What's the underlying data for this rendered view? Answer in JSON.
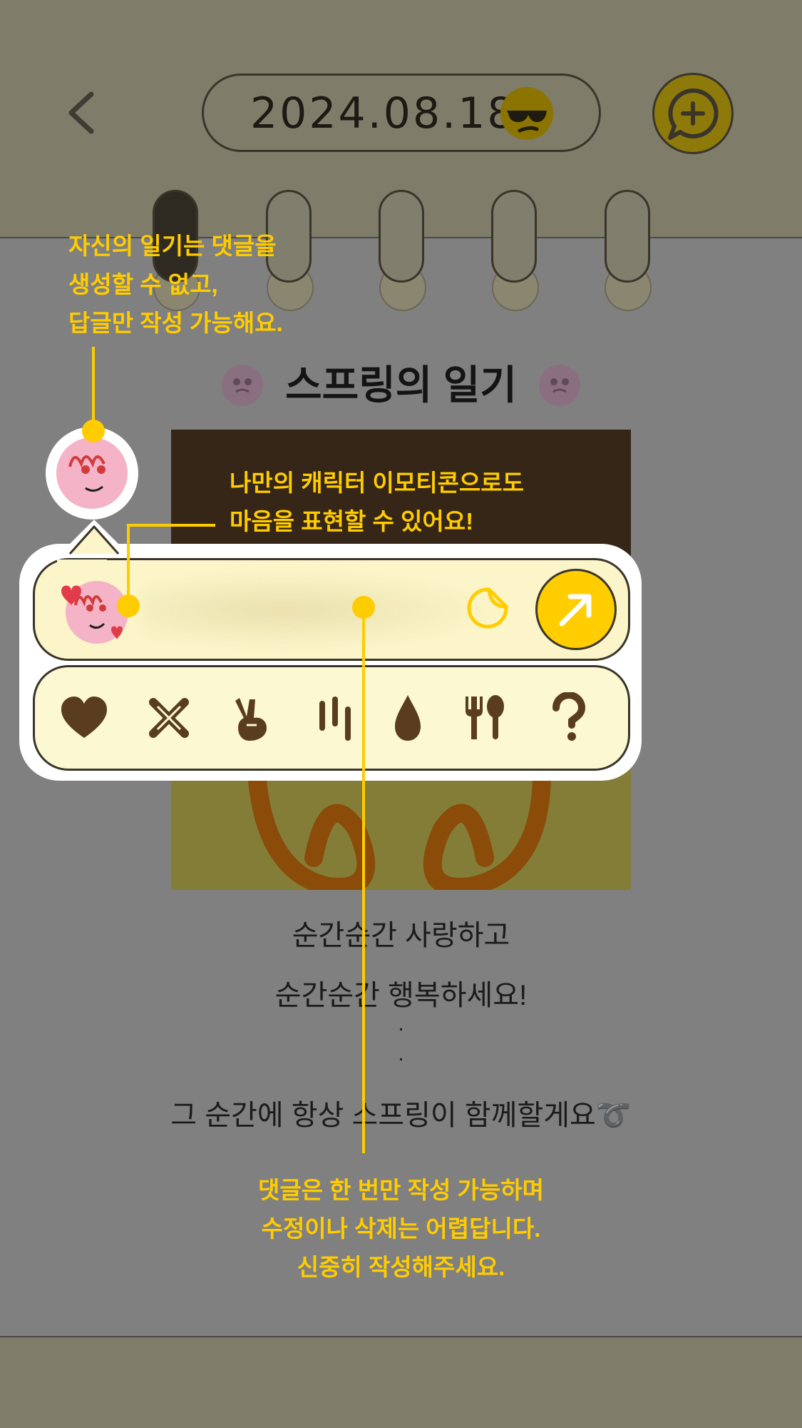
{
  "header": {
    "date": "2024.08.18",
    "back_icon": "chevron-left-icon",
    "mood_icon": "sunglasses-face-icon",
    "comment_add_icon": "chat-plus-icon"
  },
  "diary": {
    "title": "스프링의 일기",
    "body": {
      "line1": "순간순간 사랑하고",
      "line2": "순간순간 행복하세요!",
      "dot1": ".",
      "dot2": ".",
      "line3": "그 순간에 항상 스프링이 함께할게요➰"
    }
  },
  "composer": {
    "sticker_icon": "sticker-icon",
    "send_icon": "arrow-up-right-icon",
    "reactions": [
      {
        "icon": "heart-icon"
      },
      {
        "icon": "cross-bandage-icon"
      },
      {
        "icon": "victory-hand-icon"
      },
      {
        "icon": "scratch-marks-icon"
      },
      {
        "icon": "water-drop-icon"
      },
      {
        "icon": "fork-spoon-icon"
      },
      {
        "icon": "question-mark-icon"
      }
    ]
  },
  "guides": {
    "top_left": {
      "line1": "자신의 일기는 댓글을",
      "line2": "생성할 수 없고,",
      "line3": "답글만 작성 가능해요."
    },
    "emoticon": {
      "line1": "나만의 캐릭터 이모티콘으로도",
      "line2": "마음을 표현할 수 있어요!"
    },
    "bottom": {
      "line1": "댓글은 한 번만 작성 가능하며",
      "line2": "수정이나 삭제는 어렵답니다.",
      "line3": "신중히 작성해주세요."
    }
  },
  "colors": {
    "overlay_bg": "#7f7c6a",
    "accent": "#ffcc00",
    "bubble_bg": "#fbf5c9",
    "outline": "#3a352a",
    "icon_brown": "#5a3c1e"
  }
}
